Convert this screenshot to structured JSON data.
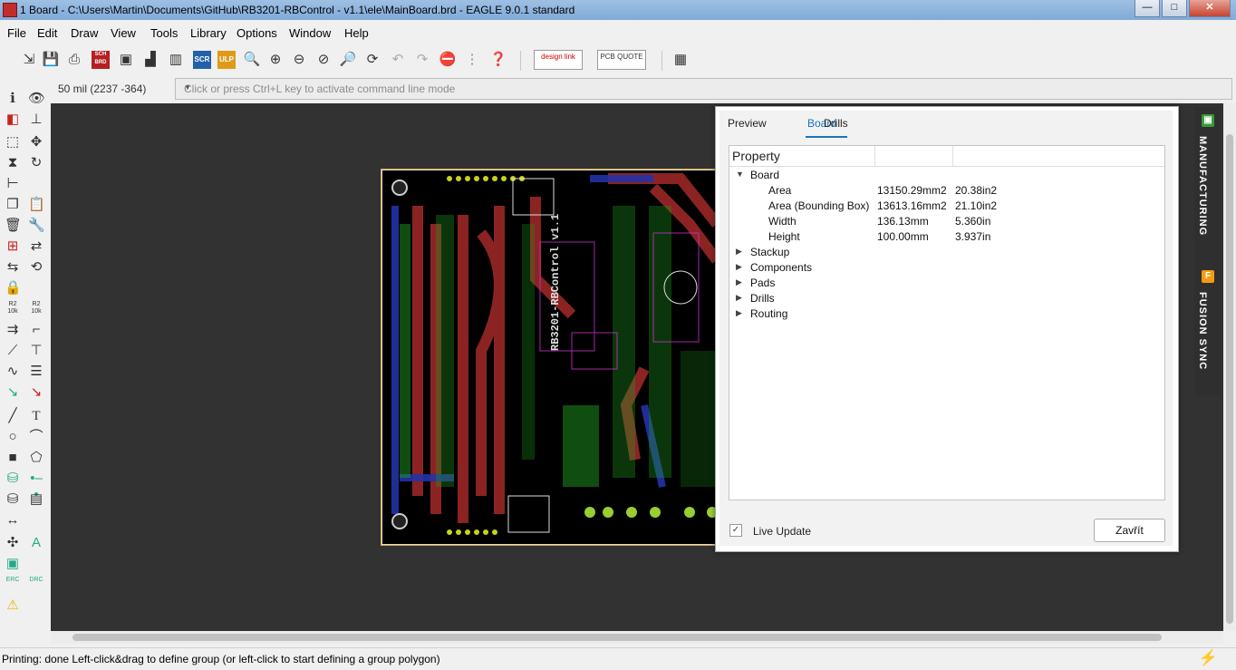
{
  "window": {
    "title": "1 Board - C:\\Users\\Martin\\Documents\\GitHub\\RB3201-RBControl - v1.1\\ele\\MainBoard.brd - EAGLE 9.0.1 standard",
    "buttons": {
      "minimize": "—",
      "maximize": "□",
      "close": "✕"
    }
  },
  "menu": [
    "File",
    "Edit",
    "Draw",
    "View",
    "Tools",
    "Library",
    "Options",
    "Window",
    "Help"
  ],
  "toolbar": {
    "scr_label": "SCR",
    "ulp_label": "ULP",
    "sch_label": "SCH BRD",
    "designlink_label": "design link",
    "pcbquote_label": "PCB QUOTE"
  },
  "command": {
    "coords": "50 mil (2237 -364)",
    "placeholder": "Click or press Ctrl+L key to activate command line mode"
  },
  "left_tools": {
    "r2_10k_a": "R2 10k",
    "r2_10k_b": "R2 10k",
    "erc": "ERC",
    "drc": "DRC",
    "text_tool": "T"
  },
  "side_tabs": {
    "manufacturing": "MANUFACTURING",
    "fusion_sync": "FUSION SYNC"
  },
  "panel": {
    "tabs": [
      "Preview",
      "Board",
      "Drills"
    ],
    "active_tab": "Board",
    "header": "Property",
    "board_group": "Board",
    "rows": [
      {
        "label": "Area",
        "v1": "13150.29mm2",
        "v2": "20.38in2"
      },
      {
        "label": "Area (Bounding Box)",
        "v1": "13613.16mm2",
        "v2": "21.10in2"
      },
      {
        "label": "Width",
        "v1": "136.13mm",
        "v2": "5.360in"
      },
      {
        "label": "Height",
        "v1": "100.00mm",
        "v2": "3.937in"
      }
    ],
    "groups": [
      "Stackup",
      "Components",
      "Pads",
      "Drills",
      "Routing"
    ],
    "live_update_label": "Live Update",
    "live_update_checked": true,
    "close_label": "Zavřít"
  },
  "pcb": {
    "silkscreen": "RB3201-RBControl v1.1"
  },
  "status": {
    "text": "Printing: done Left-click&drag to define group (or left-click to start defining a group polygon)"
  }
}
